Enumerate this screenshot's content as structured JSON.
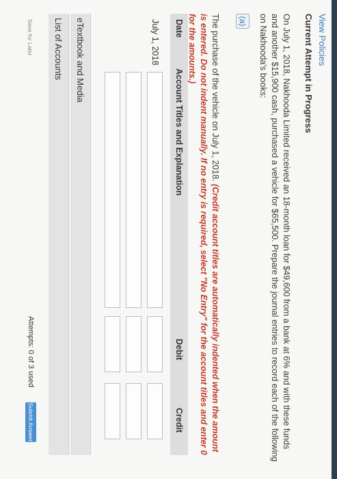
{
  "header": {
    "view_policies": "View Policies",
    "attempt_status": "Current Attempt in Progress"
  },
  "question": {
    "text": "On July 1, 2018, Nakhooda Limited received an 18-month loan for $49,600 from a bank at 6% and with these funds and another $15,900 cash, purchased a vehicle for $65,500. Prepare the journal entries to record each of the following on Nakhooda's books:"
  },
  "part": {
    "label": "(a)",
    "instruction_plain": "The purchase of the vehicle on July 1, 2018.",
    "instruction_red": "(Credit account titles are automatically indented when the amount is entered. Do not indent manually. If no entry is required, select \"No Entry\" for the account titles and enter 0 for the amounts.)"
  },
  "table": {
    "headers": {
      "date": "Date",
      "account": "Account Titles and Explanation",
      "debit": "Debit",
      "credit": "Credit"
    },
    "date_value": "July 1, 2018",
    "rows": [
      {
        "account": "",
        "debit": "",
        "credit": ""
      },
      {
        "account": "",
        "debit": "",
        "credit": ""
      },
      {
        "account": "",
        "debit": "",
        "credit": ""
      }
    ]
  },
  "links": {
    "etextbook": "eTextbook and Media",
    "accounts": "List of Accounts"
  },
  "footer": {
    "save_later": "Save for Later",
    "attempts": "Attempts: 0 of 3 used",
    "submit": "Submit Answer"
  },
  "colors": {
    "accent": "#3a7ab8",
    "instruction_red": "#c0392b",
    "submit_blue": "#4a8fd0"
  }
}
